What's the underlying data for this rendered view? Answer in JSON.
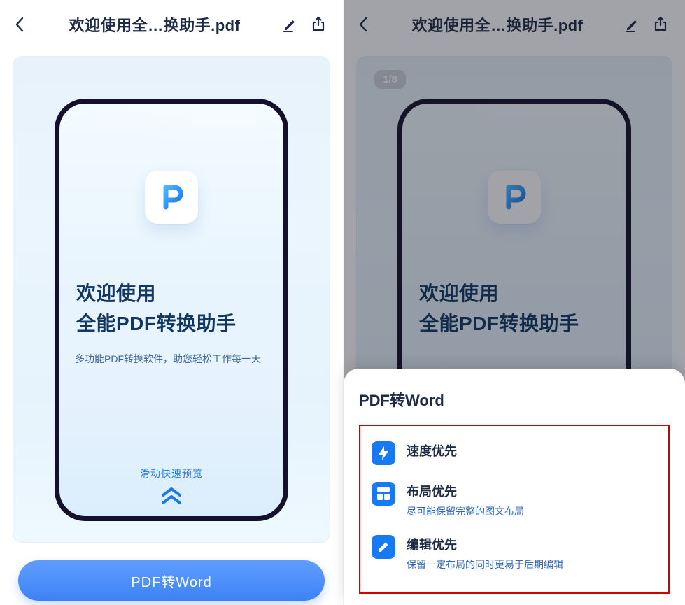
{
  "left": {
    "nav": {
      "title": "欢迎使用全…换助手.pdf"
    },
    "phone": {
      "welcome_line1": "欢迎使用",
      "welcome_line2": "全能PDF转换助手",
      "subtitle": "多功能PDF转换软件，助您轻松工作每一天",
      "swipe_hint": "滑动快速预览"
    },
    "cta_label": "PDF转Word"
  },
  "right": {
    "nav": {
      "title": "欢迎使用全…换助手.pdf"
    },
    "page_badge": "1/8",
    "phone": {
      "welcome_line1": "欢迎使用",
      "welcome_line2_partial": "全能PDF转换助手"
    },
    "sheet": {
      "title": "PDF转Word",
      "options": [
        {
          "icon": "bolt",
          "title": "速度优先",
          "desc": ""
        },
        {
          "icon": "layout",
          "title": "布局优先",
          "desc": "尽可能保留完整的图文布局"
        },
        {
          "icon": "edit",
          "title": "编辑优先",
          "desc": "保留一定布局的同时更易于后期编辑"
        }
      ]
    }
  },
  "colors": {
    "accent": "#177af2",
    "highlight_border": "#d40000"
  }
}
